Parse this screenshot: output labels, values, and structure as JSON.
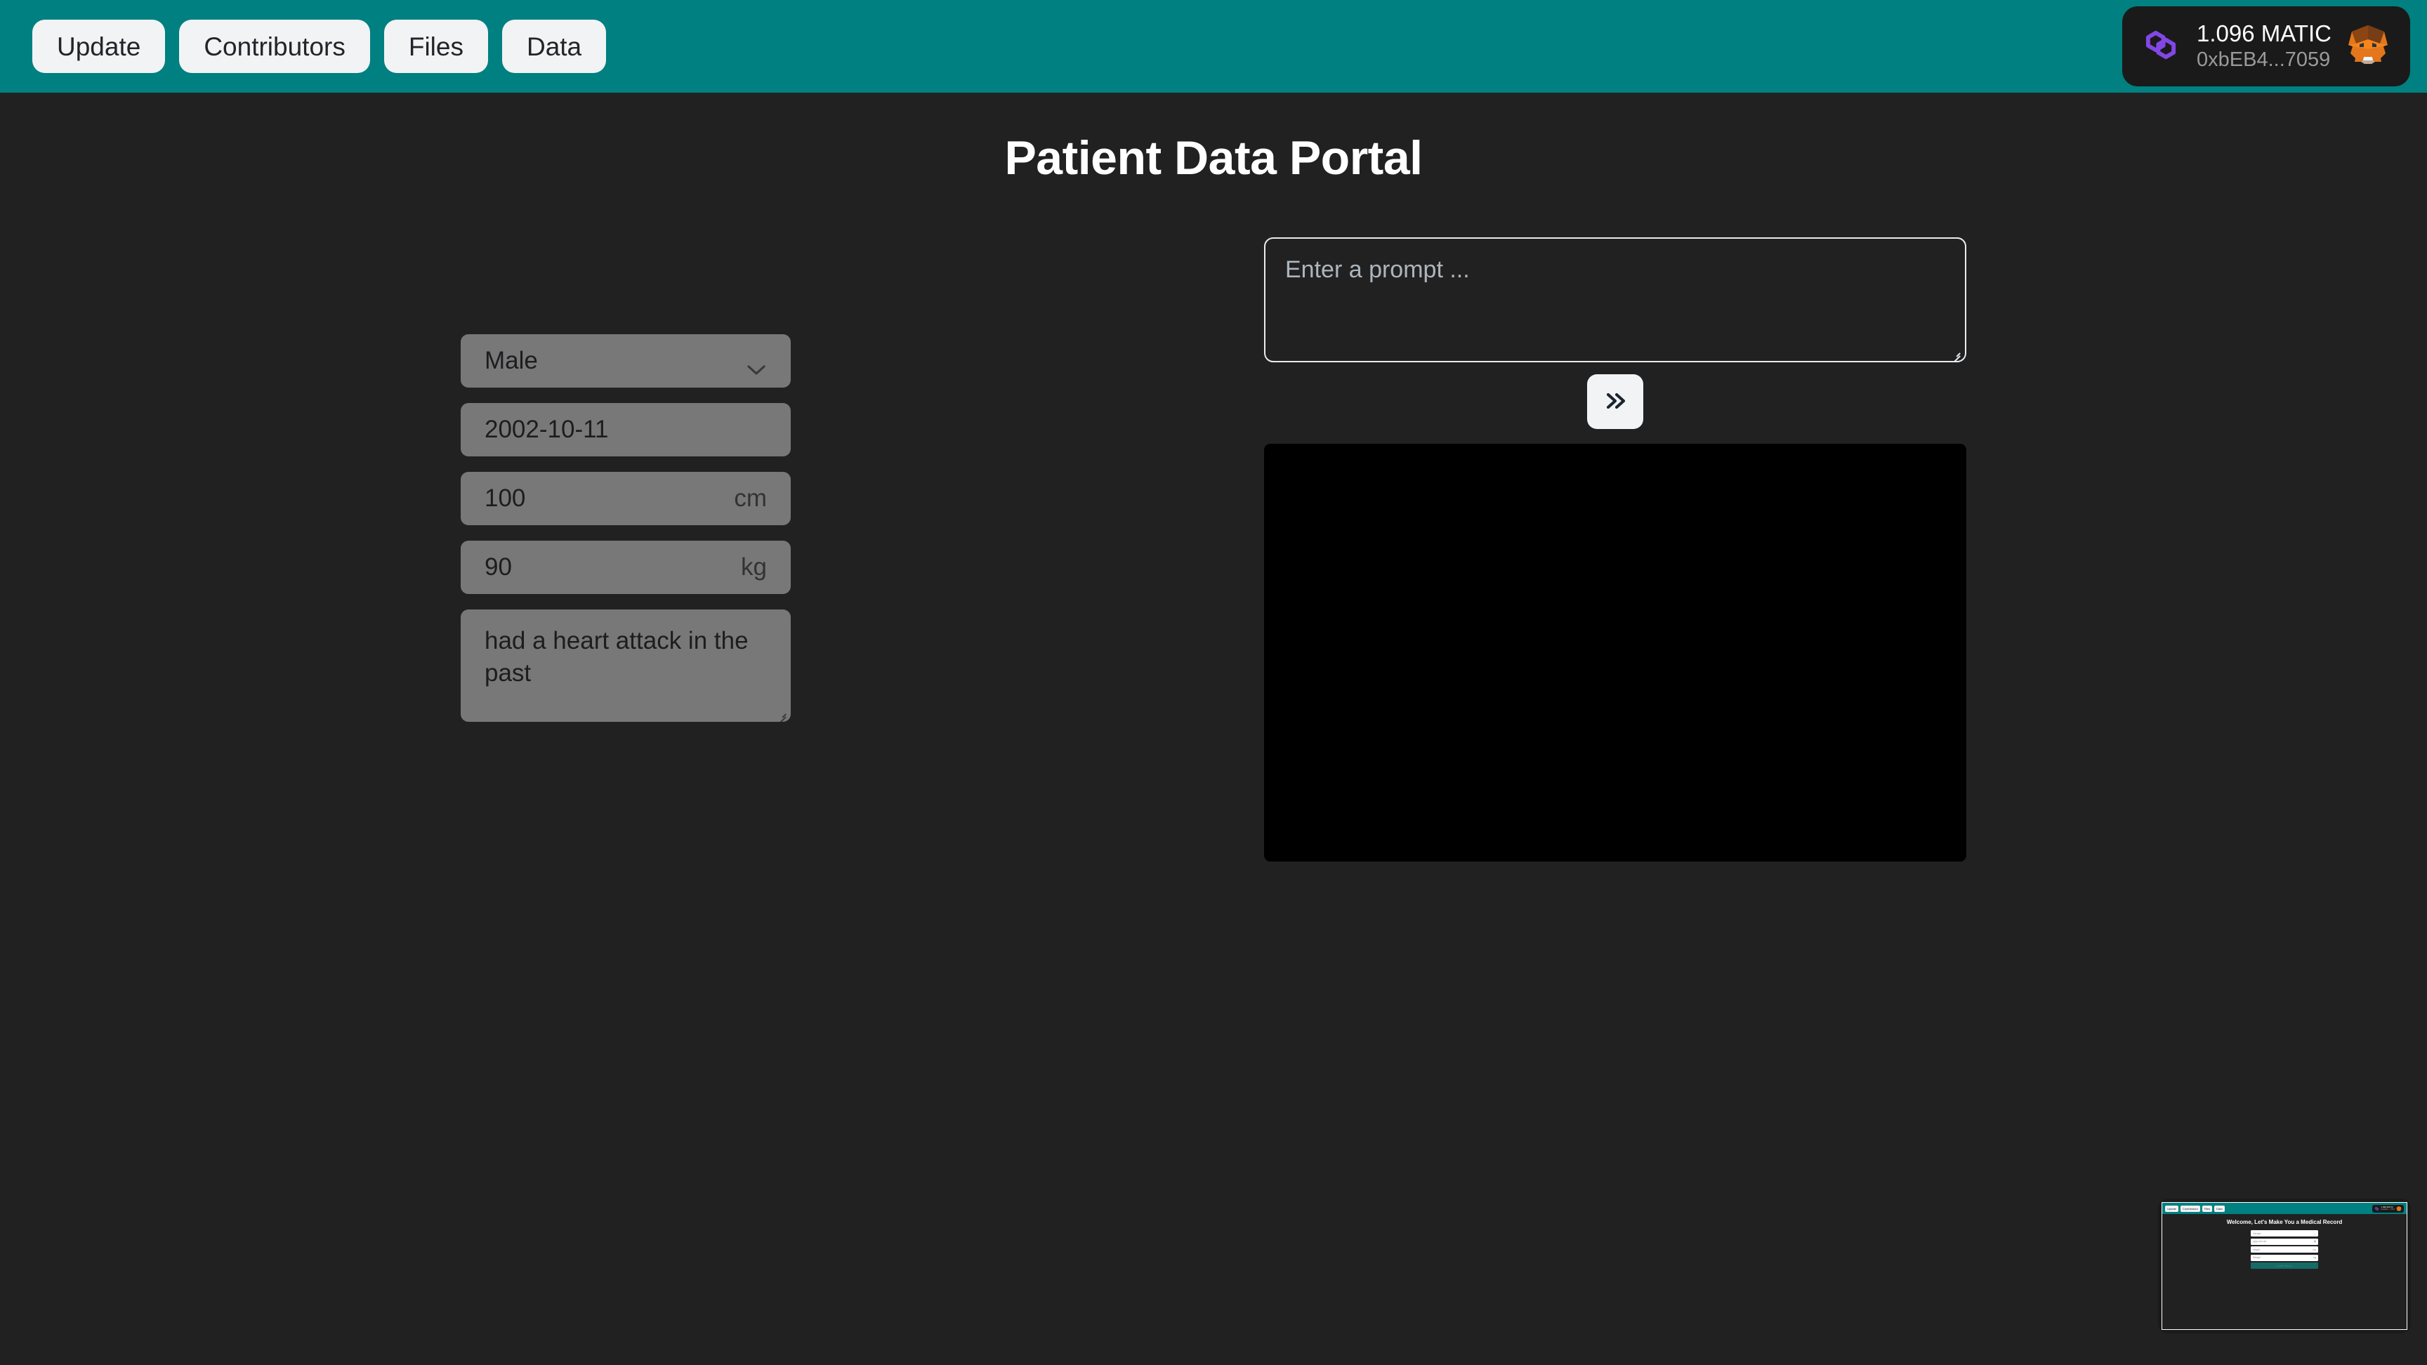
{
  "nav": {
    "buttons": [
      {
        "label": "Update",
        "name": "nav-update"
      },
      {
        "label": "Contributors",
        "name": "nav-contributors"
      },
      {
        "label": "Files",
        "name": "nav-files"
      },
      {
        "label": "Data",
        "name": "nav-data"
      }
    ]
  },
  "wallet": {
    "balance": "1.096 MATIC",
    "address": "0xbEB4...7059",
    "network_icon": "polygon-icon",
    "wallet_icon": "metamask-fox-icon"
  },
  "header": {
    "title": "Patient Data Portal"
  },
  "form": {
    "gender": {
      "value": "Male",
      "icon": "chevron-down-icon"
    },
    "birthdate": {
      "value": "2002-10-11"
    },
    "height": {
      "value": "100",
      "unit": "cm"
    },
    "weight": {
      "value": "90",
      "unit": "kg"
    },
    "notes": {
      "value": "had a heart attack in the past"
    }
  },
  "prompt": {
    "placeholder": "Enter a prompt ...",
    "value": "",
    "submit_icon": "double-chevron-right-icon"
  },
  "output": {
    "content": ""
  },
  "thumbnail": {
    "nav_buttons": [
      "Update",
      "Contributors",
      "Files",
      "Data"
    ],
    "wallet_balance": "1.096 MATIC",
    "wallet_address": "0xbEB4...7059",
    "heading": "Welcome, Let's Make You a Medical Record",
    "fields": [
      {
        "label": "Gender",
        "unit": ""
      },
      {
        "label": "yyyy-mm-dd",
        "unit": ""
      },
      {
        "label": "Height",
        "unit": "cm"
      },
      {
        "label": "Weight",
        "unit": "kg"
      }
    ],
    "submit_label": "Create Record"
  },
  "colors": {
    "teal": "#008080",
    "background": "#212121",
    "field": "#787878",
    "button": "#f1f3f5",
    "polygon_purple": "#8247E5",
    "metamask_orange": "#E2761B"
  }
}
